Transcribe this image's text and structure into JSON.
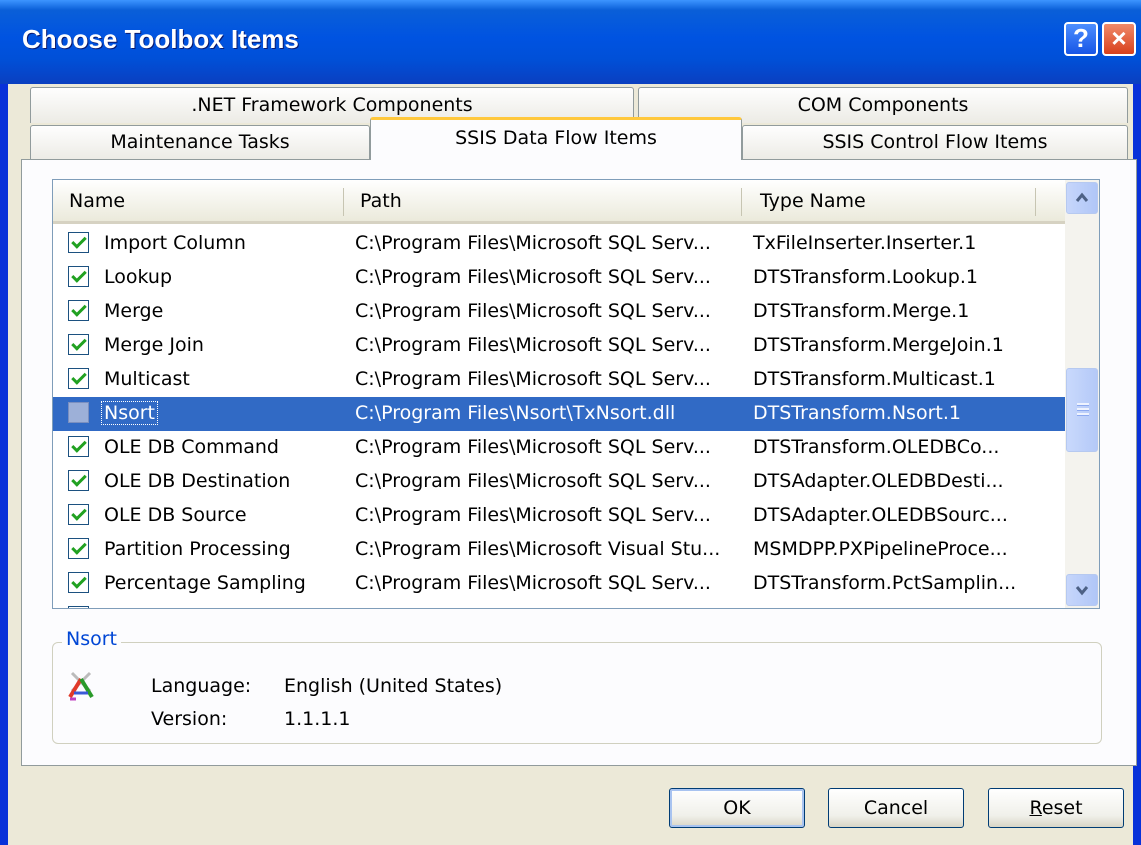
{
  "window": {
    "title": "Choose Toolbox Items",
    "help_glyph": "?",
    "close_glyph": "×"
  },
  "tabs": {
    "row_back": [
      ".NET Framework Components",
      "COM Components"
    ],
    "row_front": [
      "Maintenance Tasks",
      "SSIS Data Flow Items",
      "SSIS Control Flow Items"
    ],
    "active": "SSIS Data Flow Items"
  },
  "list": {
    "columns": [
      "Name",
      "Path",
      "Type Name"
    ],
    "rows": [
      {
        "checked": true,
        "name": "Import Column",
        "path": "C:\\Program Files\\Microsoft SQL Serv...",
        "type": "TxFileInserter.Inserter.1"
      },
      {
        "checked": true,
        "name": "Lookup",
        "path": "C:\\Program Files\\Microsoft SQL Serv...",
        "type": "DTSTransform.Lookup.1"
      },
      {
        "checked": true,
        "name": "Merge",
        "path": "C:\\Program Files\\Microsoft SQL Serv...",
        "type": "DTSTransform.Merge.1"
      },
      {
        "checked": true,
        "name": "Merge Join",
        "path": "C:\\Program Files\\Microsoft SQL Serv...",
        "type": "DTSTransform.MergeJoin.1"
      },
      {
        "checked": true,
        "name": "Multicast",
        "path": "C:\\Program Files\\Microsoft SQL Serv...",
        "type": "DTSTransform.Multicast.1"
      },
      {
        "checked": false,
        "selected": true,
        "name": "Nsort",
        "path": "C:\\Program Files\\Nsort\\TxNsort.dll",
        "type": "DTSTransform.Nsort.1"
      },
      {
        "checked": true,
        "name": "OLE DB Command",
        "path": "C:\\Program Files\\Microsoft SQL Serv...",
        "type": "DTSTransform.OLEDBCo..."
      },
      {
        "checked": true,
        "name": "OLE DB Destination",
        "path": "C:\\Program Files\\Microsoft SQL Serv...",
        "type": "DTSAdapter.OLEDBDesti..."
      },
      {
        "checked": true,
        "name": "OLE DB Source",
        "path": "C:\\Program Files\\Microsoft SQL Serv...",
        "type": "DTSAdapter.OLEDBSourc..."
      },
      {
        "checked": true,
        "name": "Partition Processing",
        "path": "C:\\Program Files\\Microsoft Visual Stu...",
        "type": "MSMDPP.PXPipelineProce..."
      },
      {
        "checked": true,
        "name": "Percentage Sampling",
        "path": "C:\\Program Files\\Microsoft SQL Serv...",
        "type": "DTSTransform.PctSamplin..."
      }
    ]
  },
  "details": {
    "title": "Nsort",
    "language_label": "Language:",
    "language_value": "English (United States)",
    "version_label": "Version:",
    "version_value": "1.1.1.1"
  },
  "buttons": {
    "ok": "OK",
    "cancel": "Cancel",
    "reset_first": "R",
    "reset_rest": "eset"
  }
}
